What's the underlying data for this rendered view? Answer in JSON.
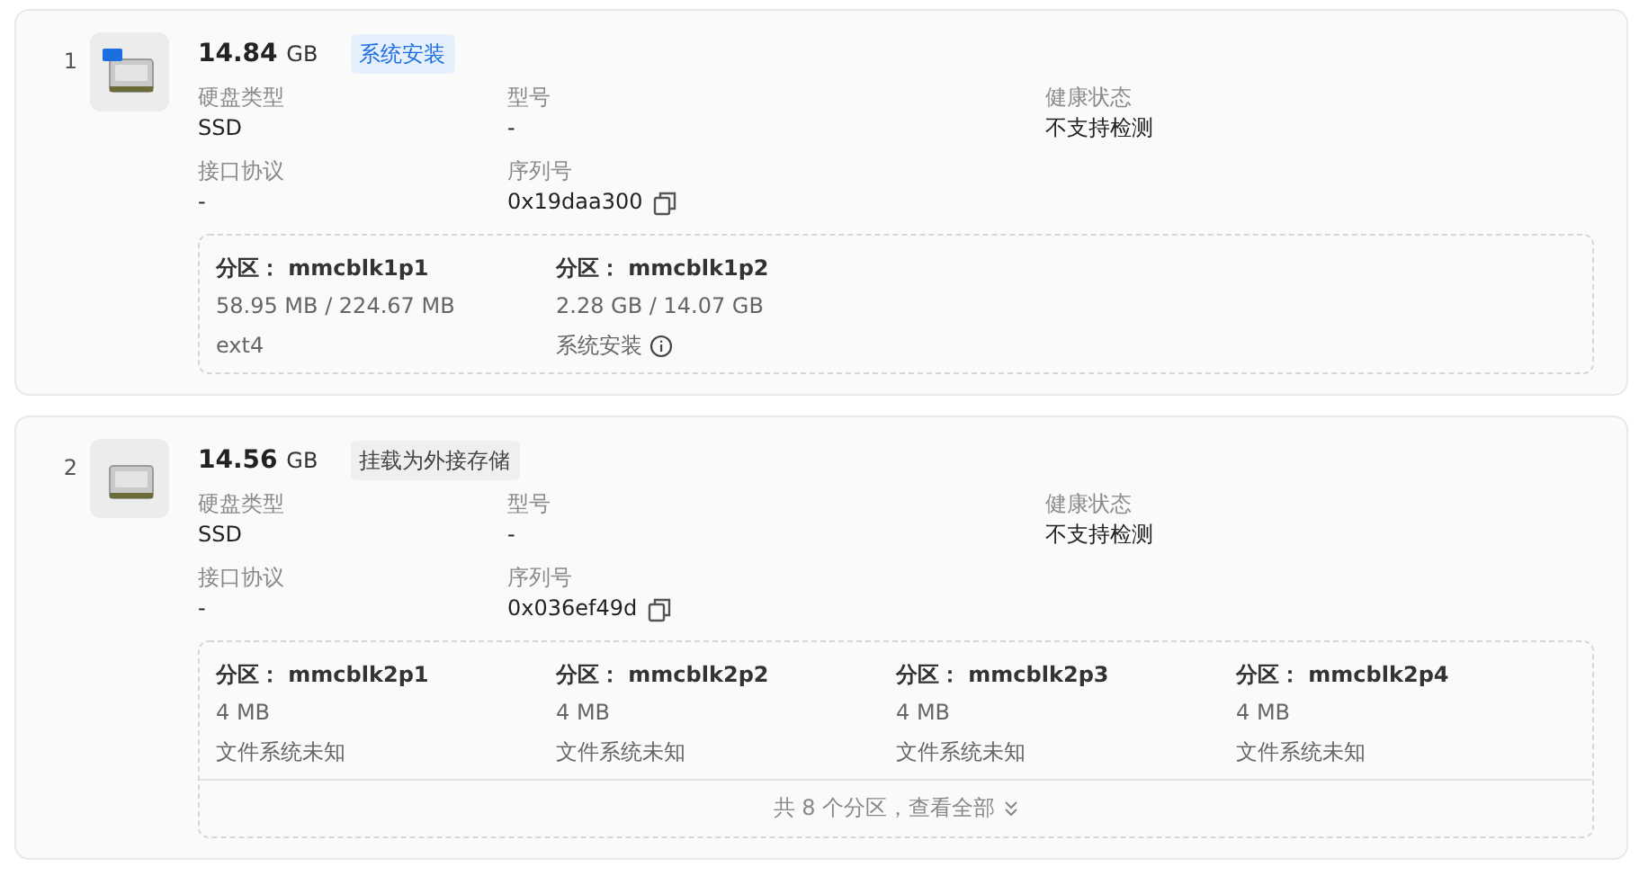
{
  "disks": [
    {
      "index": "1",
      "os": true,
      "size": "14.84",
      "unit": "GB",
      "tag": {
        "text": "系统安装",
        "kind": "system"
      },
      "fields": [
        {
          "label": "硬盘类型",
          "value": "SSD"
        },
        {
          "label": "型号",
          "value": "-"
        },
        {
          "label": "健康状态",
          "value": "不支持检测"
        },
        {
          "label": "接口协议",
          "value": "-"
        },
        {
          "label": "序列号",
          "value": "0x19daa300",
          "copyable": true
        }
      ],
      "partitions": [
        {
          "title": "分区： mmcblk1p1",
          "size": "58.95 MB / 224.67 MB",
          "fs": "ext4",
          "info": false
        },
        {
          "title": "分区： mmcblk1p2",
          "size": "2.28 GB / 14.07 GB",
          "fs": "系统安装",
          "info": true
        }
      ]
    },
    {
      "index": "2",
      "os": false,
      "size": "14.56",
      "unit": "GB",
      "tag": {
        "text": "挂载为外接存储",
        "kind": "external"
      },
      "fields": [
        {
          "label": "硬盘类型",
          "value": "SSD"
        },
        {
          "label": "型号",
          "value": "-"
        },
        {
          "label": "健康状态",
          "value": "不支持检测"
        },
        {
          "label": "接口协议",
          "value": "-"
        },
        {
          "label": "序列号",
          "value": "0x036ef49d",
          "copyable": true
        }
      ],
      "partitions": [
        {
          "title": "分区： mmcblk2p1",
          "size": "4 MB",
          "fs": "文件系统未知",
          "info": false
        },
        {
          "title": "分区： mmcblk2p2",
          "size": "4 MB",
          "fs": "文件系统未知",
          "info": false
        },
        {
          "title": "分区： mmcblk2p3",
          "size": "4 MB",
          "fs": "文件系统未知",
          "info": false
        },
        {
          "title": "分区： mmcblk2p4",
          "size": "4 MB",
          "fs": "文件系统未知",
          "info": false
        }
      ],
      "more": "共 8 个分区，查看全部"
    }
  ]
}
